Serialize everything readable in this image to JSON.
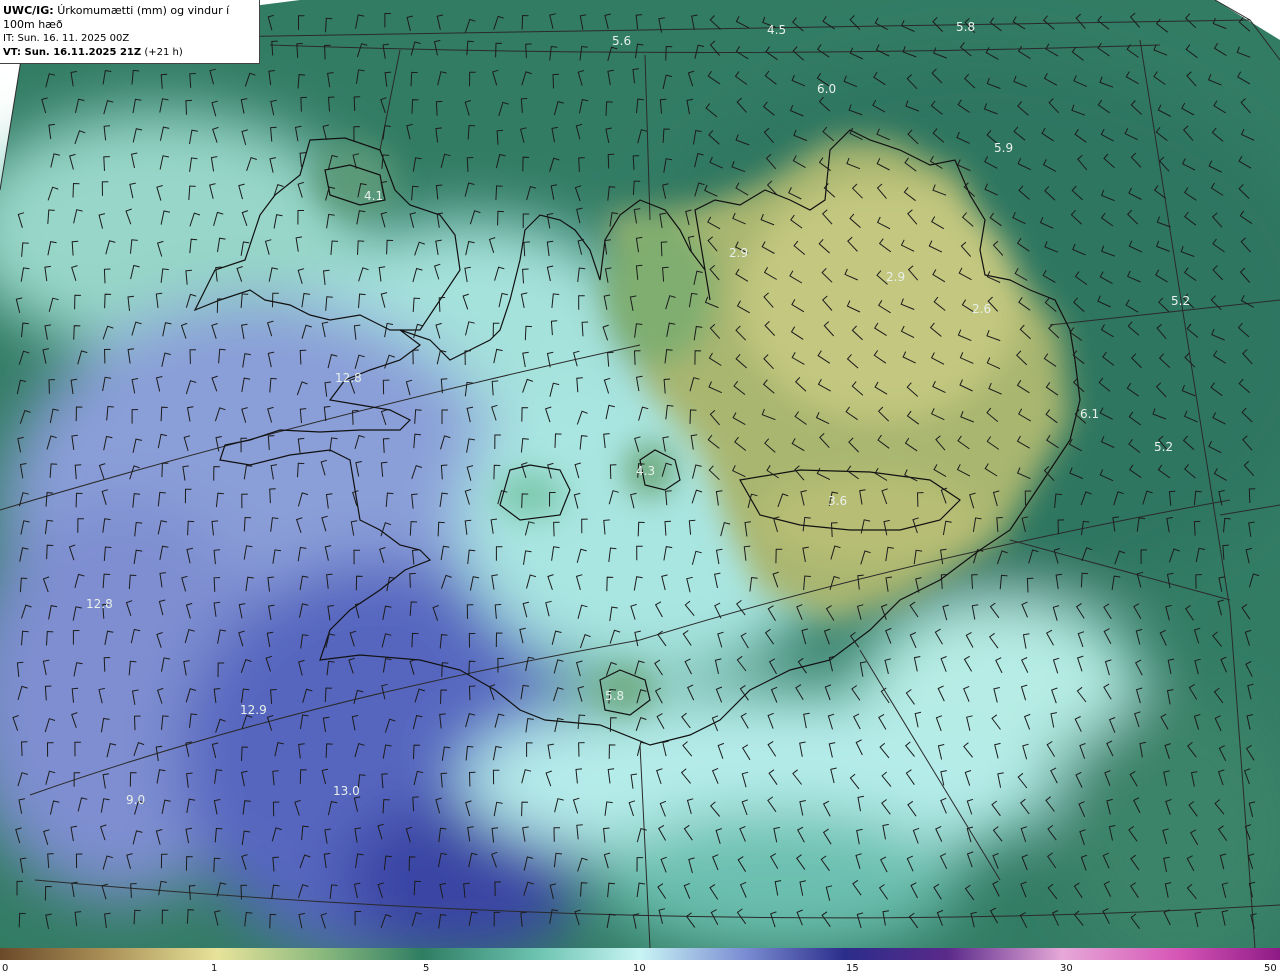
{
  "header": {
    "model": "UWC/IG:",
    "title": "Úrkomumætti (mm) og vindur í 100m hæð",
    "init_time": "IT: Sun. 16. 11. 2025 00Z",
    "valid_label": "VT: Sun. 16.11.2025 21Z",
    "valid_offset": "(+21 h)"
  },
  "colorbar": {
    "ticks": [
      "0",
      "1",
      "5",
      "10",
      "15",
      "30",
      "50"
    ]
  },
  "map_values": [
    {
      "label": "5.6"
    },
    {
      "label": "4.5"
    },
    {
      "label": "5.8"
    },
    {
      "label": "6.0"
    },
    {
      "label": "5.9"
    },
    {
      "label": "4.1"
    },
    {
      "label": "2.9"
    },
    {
      "label": "2.9"
    },
    {
      "label": "2.6"
    },
    {
      "label": "5.2"
    },
    {
      "label": "6.1"
    },
    {
      "label": "5.2"
    },
    {
      "label": "12.8"
    },
    {
      "label": "4.3"
    },
    {
      "label": "12.8"
    },
    {
      "label": "3.6"
    },
    {
      "label": "5.8"
    },
    {
      "label": "12.9"
    },
    {
      "label": "13.0"
    },
    {
      "label": "9.0"
    }
  ],
  "colors": {
    "ocean_deep": "#2f7a63",
    "ocean_mid": "#4f9c80",
    "light_cyan": "#a6e2e0",
    "blue": "#6a78c8",
    "dark_blue": "#3d48a8",
    "land_yellow": "#b9c27a",
    "land_green": "#6fa472"
  }
}
